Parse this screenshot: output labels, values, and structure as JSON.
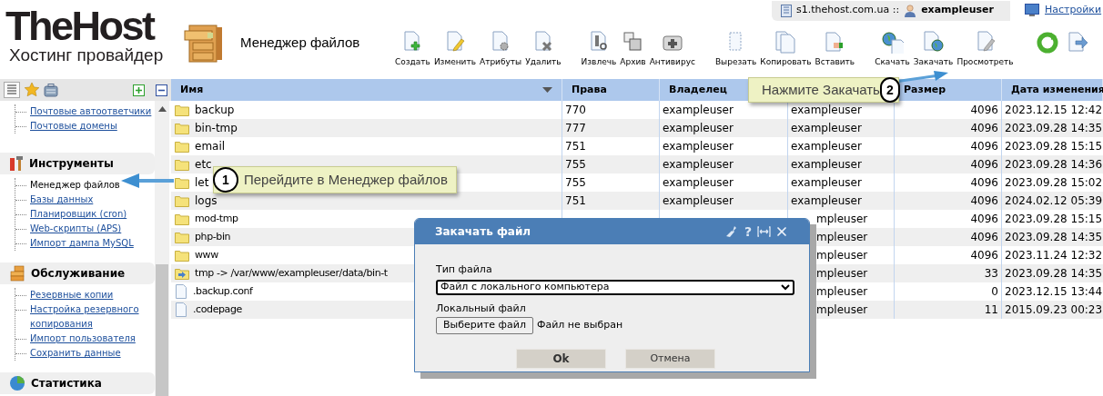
{
  "logo": {
    "name": "TheHost",
    "tagline": "Хостинг провайдер"
  },
  "page_title": "Менеджер файлов",
  "server_bar": {
    "server": "s1.thehost.com.ua ::",
    "user": "exampleuser"
  },
  "settings_link": "Настройки",
  "toolbar": [
    {
      "buttons": [
        {
          "label": "Создать",
          "kind": "create"
        },
        {
          "label": "Изменить",
          "kind": "edit"
        },
        {
          "label": "Атрибуты",
          "kind": "attributes"
        },
        {
          "label": "Удалить",
          "kind": "delete"
        }
      ]
    },
    {
      "buttons": [
        {
          "label": "Извлечь",
          "kind": "extract"
        },
        {
          "label": "Архив",
          "kind": "archive"
        },
        {
          "label": "Антивирус",
          "kind": "antivirus"
        }
      ]
    },
    {
      "buttons": [
        {
          "label": "Вырезать",
          "kind": "cut"
        },
        {
          "label": "Копировать",
          "kind": "copy"
        },
        {
          "label": "Вставить",
          "kind": "paste"
        }
      ]
    },
    {
      "buttons": [
        {
          "label": "Скачать",
          "kind": "download"
        },
        {
          "label": "Закачать",
          "kind": "upload"
        },
        {
          "label": "Просмотреть",
          "kind": "view"
        }
      ]
    },
    {
      "buttons": [
        {
          "kind": "refresh"
        },
        {
          "kind": "exit"
        }
      ]
    }
  ],
  "sidebar": {
    "top_items": [
      {
        "label": "Почтовые автоответчики",
        "selected": false
      },
      {
        "label": "Почтовые домены",
        "selected": false
      }
    ],
    "sections": [
      {
        "title": "Инструменты",
        "kind": "tools",
        "items": [
          {
            "label": "Менеджер файлов",
            "selected": true
          },
          {
            "label": "Базы данных",
            "selected": false
          },
          {
            "label": "Планировщик (cron)",
            "selected": false
          },
          {
            "label": "Web-скрипты (APS)",
            "selected": false
          },
          {
            "label": "Импорт дампа MySQL",
            "selected": false
          }
        ]
      },
      {
        "title": "Обслуживание",
        "kind": "service",
        "items": [
          {
            "label": "Резервные копии",
            "selected": false
          },
          {
            "label": "Настройка резервного копирования",
            "selected": false
          },
          {
            "label": "Импорт пользователя",
            "selected": false
          },
          {
            "label": "Сохранить данные",
            "selected": false
          }
        ]
      },
      {
        "title": "Статистика",
        "kind": "stats"
      }
    ]
  },
  "table": {
    "columns": [
      {
        "label": "Имя"
      },
      {
        "label": "Права"
      },
      {
        "label": "Владелец"
      },
      {},
      {
        "label": "Размер"
      },
      {
        "label": "Дата изменения"
      }
    ],
    "rows": [
      {
        "kind": "folder",
        "name": "backup",
        "perms": "770",
        "owner": "exampleuser",
        "group": "exampleuser",
        "size": "4096",
        "date": "2023.12.15 12:42",
        "covered": false
      },
      {
        "kind": "folder",
        "name": "bin-tmp",
        "perms": "777",
        "owner": "exampleuser",
        "group": "exampleuser",
        "size": "4096",
        "date": "2023.09.28 14:35",
        "covered": false
      },
      {
        "kind": "folder",
        "name": "email",
        "perms": "751",
        "owner": "exampleuser",
        "group": "exampleuser",
        "size": "4096",
        "date": "2023.09.28 15:15",
        "covered": false
      },
      {
        "kind": "folder",
        "name": "etc",
        "perms": "755",
        "owner": "exampleuser",
        "group": "exampleuser",
        "size": "4096",
        "date": "2023.09.28 14:36",
        "covered": false
      },
      {
        "kind": "folder",
        "name": "let",
        "perms": "755",
        "owner": "exampleuser",
        "group": "exampleuser",
        "size": "4096",
        "date": "2023.09.28 15:02",
        "covered": false
      },
      {
        "kind": "folder",
        "name": "logs",
        "perms": "751",
        "owner": "exampleuser",
        "group": "exampleuser",
        "size": "4096",
        "date": "2024.02.12 05:39",
        "covered": false
      },
      {
        "kind": "folder",
        "name": "mod-tmp",
        "group": "mpleuser",
        "size": "4096",
        "date": "2023.09.28 15:15",
        "covered": true
      },
      {
        "kind": "folder",
        "name": "php-bin",
        "group": "mpleuser",
        "size": "4096",
        "date": "2023.09.28 14:35",
        "covered": true
      },
      {
        "kind": "folder",
        "name": "www",
        "group": "mpleuser",
        "size": "4096",
        "date": "2023.11.24 12:32",
        "covered": true
      },
      {
        "kind": "link",
        "name": "tmp -> /var/www/exampleuser/data/bin-t",
        "group": "mpleuser",
        "size": "33",
        "date": "2023.09.28 14:35",
        "covered": true
      },
      {
        "kind": "file",
        "name": ".backup.conf",
        "group": "mpleuser",
        "size": "0",
        "date": "2023.12.15 13:44",
        "covered": true
      },
      {
        "kind": "file",
        "name": ".codepage",
        "group": "mpleuser",
        "size": "11",
        "date": "2015.09.23 00:23",
        "covered": true
      }
    ]
  },
  "callouts": [
    {
      "number": "1",
      "text": "Перейдите в Менеджер файлов"
    },
    {
      "number": "2",
      "text": "Нажмите Закачать"
    }
  ],
  "dialog": {
    "title": "Закачать файл",
    "help": "?",
    "type_label": "Тип файла",
    "type_value": "Файл с локального компьютера",
    "file_label": "Локальный файл",
    "choose_button": "Выберите файл",
    "file_status": "Файл не выбран",
    "ok": "Ok",
    "cancel": "Отмена"
  }
}
